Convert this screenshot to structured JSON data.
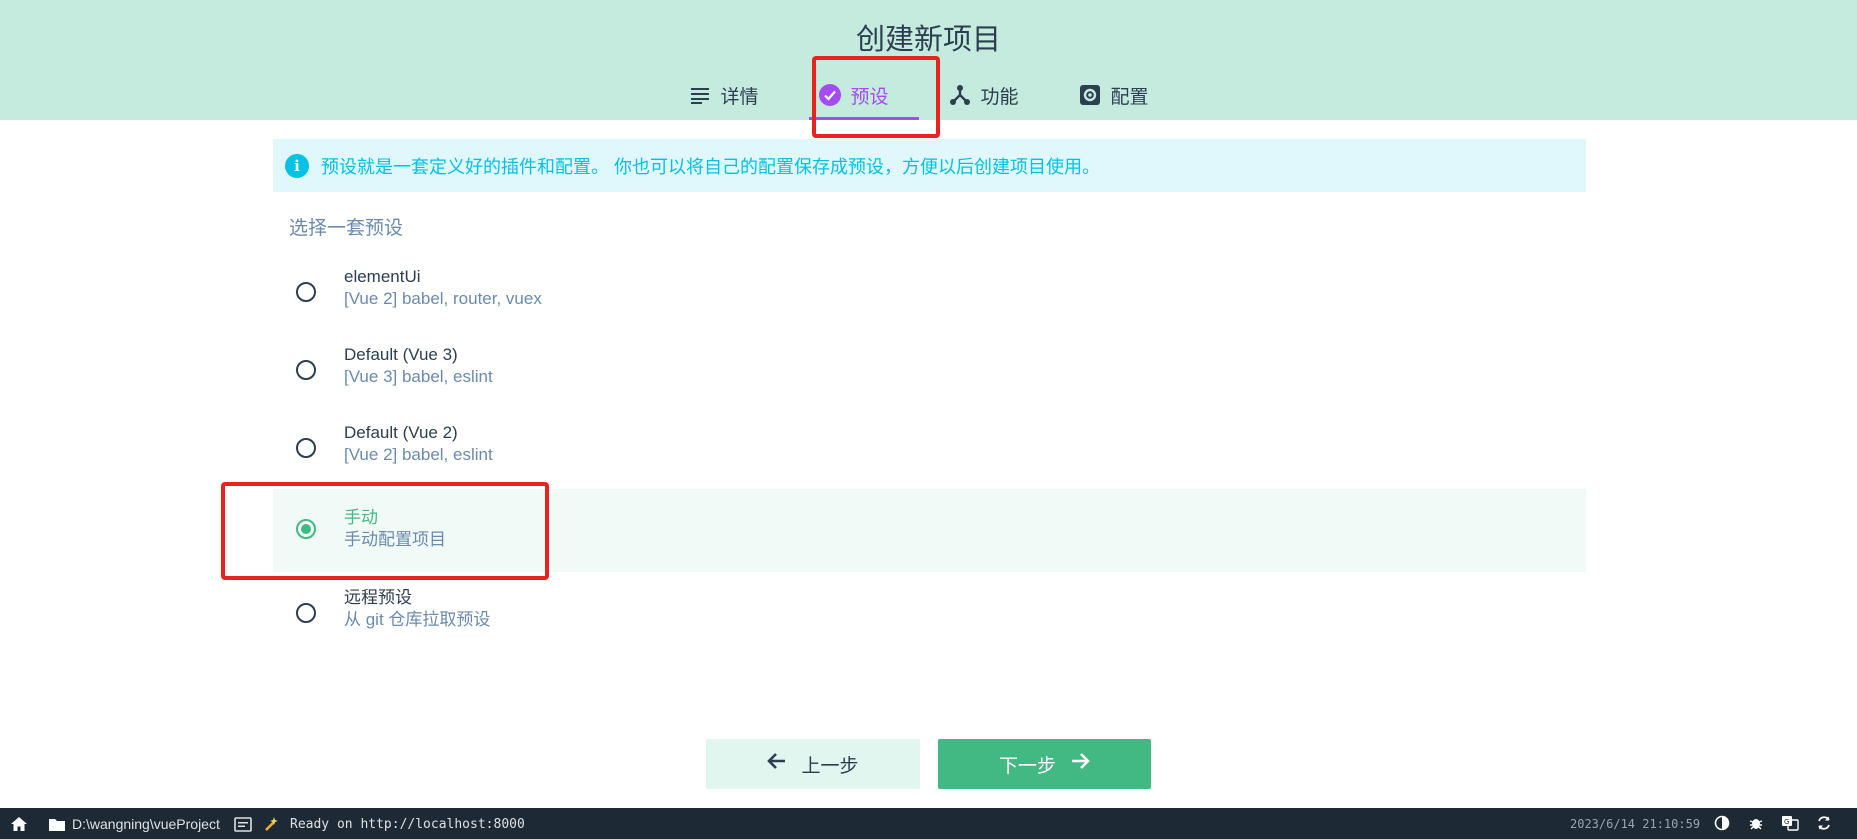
{
  "header": {
    "title": "创建新项目",
    "tabs": [
      {
        "label": "详情",
        "icon": "list-icon"
      },
      {
        "label": "预设",
        "icon": "check-circle-icon"
      },
      {
        "label": "功能",
        "icon": "fork-icon"
      },
      {
        "label": "配置",
        "icon": "settings-icon"
      }
    ],
    "active_tab": 1
  },
  "info": {
    "text": "预设就是一套定义好的插件和配置。 你也可以将自己的配置保存成预设，方便以后创建项目使用。",
    "icon": "info-icon"
  },
  "main": {
    "section_label": "选择一套预设",
    "presets": [
      {
        "name": "elementUi",
        "desc": "[Vue 2] babel, router, vuex"
      },
      {
        "name": "Default (Vue 3)",
        "desc": "[Vue 3] babel, eslint"
      },
      {
        "name": "Default (Vue 2)",
        "desc": "[Vue 2] babel, eslint"
      },
      {
        "name": "手动",
        "desc": "手动配置项目"
      },
      {
        "name": "远程预设",
        "desc": "从 git 仓库拉取预设"
      }
    ],
    "selected_index": 3
  },
  "buttons": {
    "prev_label": "上一步",
    "next_label": "下一步"
  },
  "statusbar": {
    "folder": "D:\\wangning\\vueProject",
    "log": "Ready on http://localhost:8000",
    "time": "2023/6/14 21:10:59"
  },
  "colors": {
    "header_bg": "#c5ebdf",
    "accent_purple": "#a44cf2",
    "accent_green": "#42b983",
    "info_cyan": "#03c2e6",
    "highlight": "#e8231f",
    "statusbar_bg": "#1d2935"
  }
}
